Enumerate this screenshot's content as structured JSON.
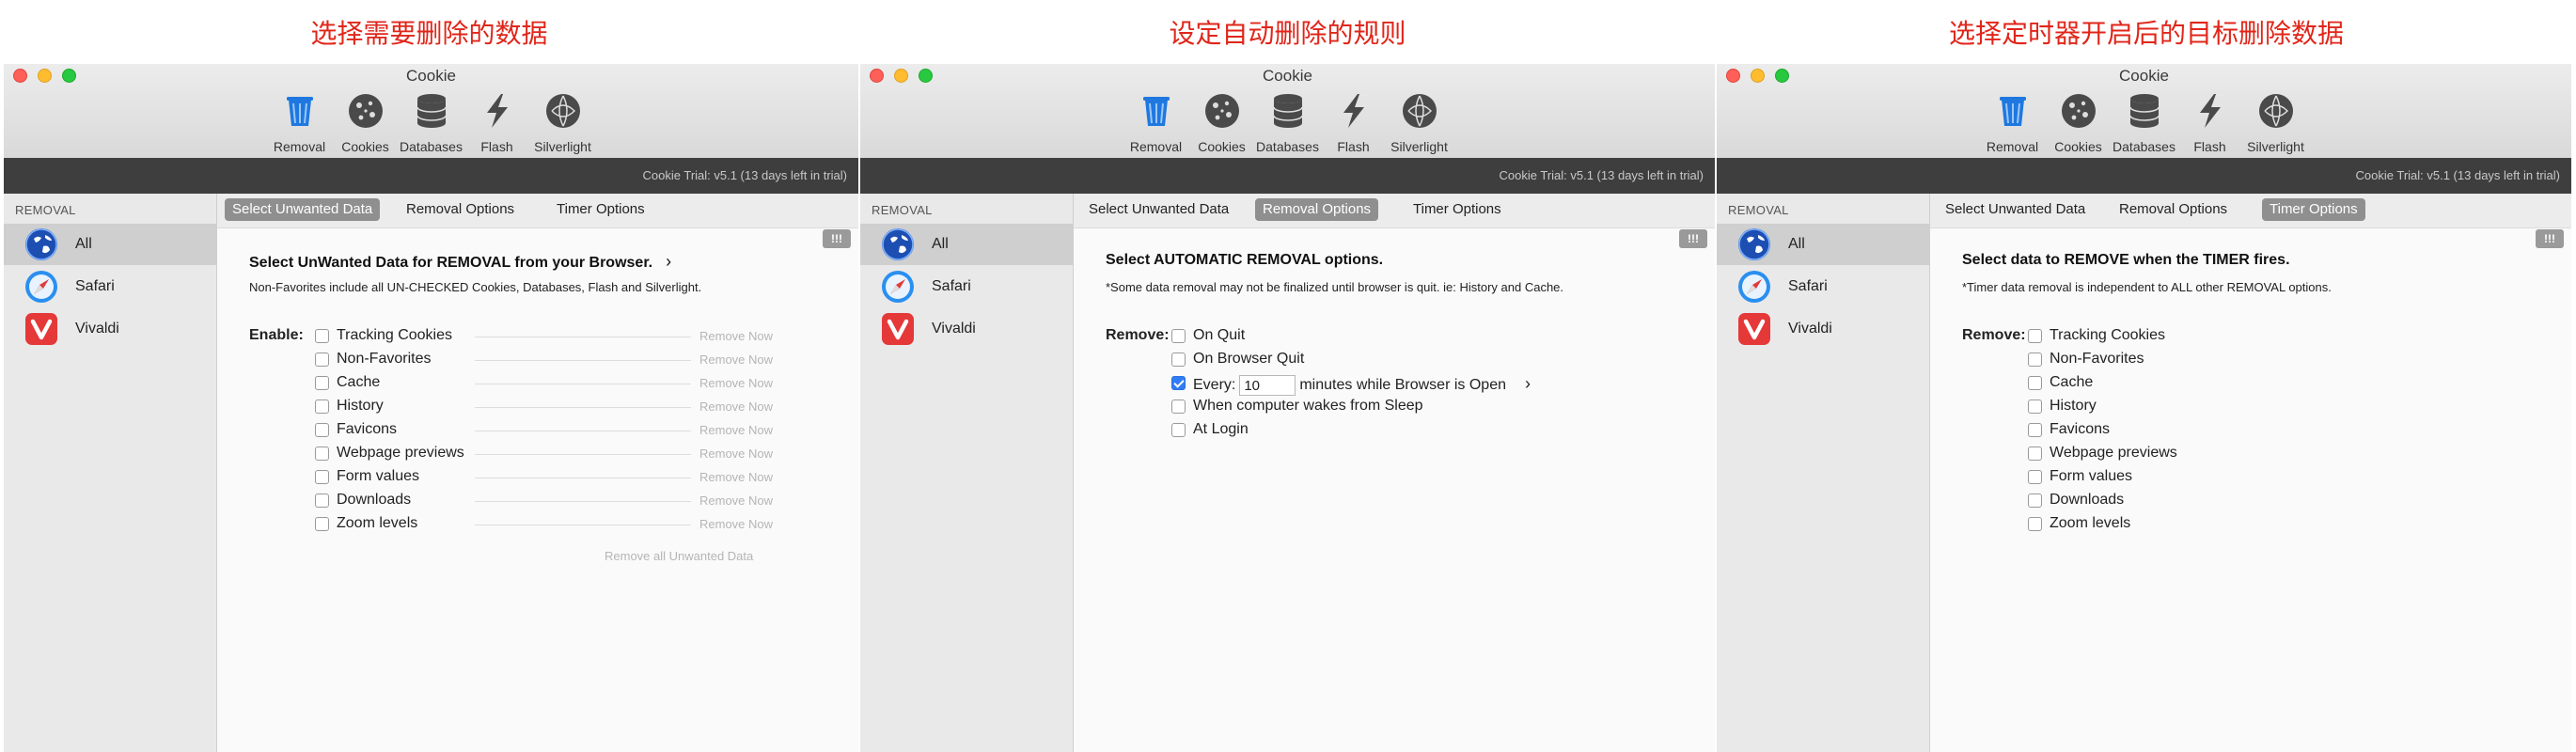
{
  "captions": [
    "选择需要删除的数据",
    "设定自动删除的规则",
    "选择定时器开启后的目标删除数据"
  ],
  "app": {
    "title": "Cookie",
    "toolbar": [
      {
        "label": "Removal",
        "icon": "trash-icon",
        "color": "#1e78e0"
      },
      {
        "label": "Cookies",
        "icon": "cookie-icon"
      },
      {
        "label": "Databases",
        "icon": "database-icon"
      },
      {
        "label": "Flash",
        "icon": "flash-icon"
      },
      {
        "label": "Silverlight",
        "icon": "silverlight-icon"
      }
    ],
    "status": "Cookie Trial: v5.1 (13 days left in trial)",
    "sidebar": {
      "header": "REMOVAL",
      "items": [
        {
          "label": "All",
          "icon": "globe-icon"
        },
        {
          "label": "Safari",
          "icon": "safari-icon"
        },
        {
          "label": "Vivaldi",
          "icon": "vivaldi-icon"
        }
      ]
    },
    "tabs": [
      "Select Unwanted Data",
      "Removal Options",
      "Timer Options"
    ],
    "badge": "!!!"
  },
  "panels": [
    {
      "active_tab": 0,
      "heading": "Select UnWanted Data for REMOVAL from your Browser.",
      "has_chevron": true,
      "note": "Non-Favorites include all UN-CHECKED Cookies, Databases, Flash and Silverlight.",
      "label": "Enable:",
      "options": [
        {
          "label": "Tracking Cookies",
          "checked": false,
          "action": "Remove Now"
        },
        {
          "label": "Non-Favorites",
          "checked": false,
          "action": "Remove Now"
        },
        {
          "label": "Cache",
          "checked": false,
          "action": "Remove Now"
        },
        {
          "label": "History",
          "checked": false,
          "action": "Remove Now"
        },
        {
          "label": "Favicons",
          "checked": false,
          "action": "Remove Now"
        },
        {
          "label": "Webpage previews",
          "checked": false,
          "action": "Remove Now"
        },
        {
          "label": "Form values",
          "checked": false,
          "action": "Remove Now"
        },
        {
          "label": "Downloads",
          "checked": false,
          "action": "Remove Now"
        },
        {
          "label": "Zoom levels",
          "checked": false,
          "action": "Remove Now"
        }
      ],
      "remove_all": "Remove all Unwanted Data"
    },
    {
      "active_tab": 1,
      "heading": "Select AUTOMATIC REMOVAL options.",
      "note": "*Some data removal may not be finalized until browser is quit. ie: History and Cache.",
      "label": "Remove:",
      "options": [
        {
          "label": "On Quit",
          "checked": false
        },
        {
          "label": "On Browser Quit",
          "checked": false
        },
        {
          "label": "Every:",
          "checked": true,
          "value": "10",
          "suffix": "minutes while Browser is Open"
        },
        {
          "label": "When computer wakes from Sleep",
          "checked": false
        },
        {
          "label": "At Login",
          "checked": false
        }
      ]
    },
    {
      "active_tab": 2,
      "heading": "Select data to REMOVE when the TIMER fires.",
      "note": "*Timer data removal is independent to ALL other REMOVAL options.",
      "label": "Remove:",
      "options": [
        {
          "label": "Tracking Cookies",
          "checked": false
        },
        {
          "label": "Non-Favorites",
          "checked": false
        },
        {
          "label": "Cache",
          "checked": false
        },
        {
          "label": "History",
          "checked": false
        },
        {
          "label": "Favicons",
          "checked": false
        },
        {
          "label": "Webpage previews",
          "checked": false
        },
        {
          "label": "Form values",
          "checked": false
        },
        {
          "label": "Downloads",
          "checked": false
        },
        {
          "label": "Zoom levels",
          "checked": false
        }
      ]
    }
  ]
}
